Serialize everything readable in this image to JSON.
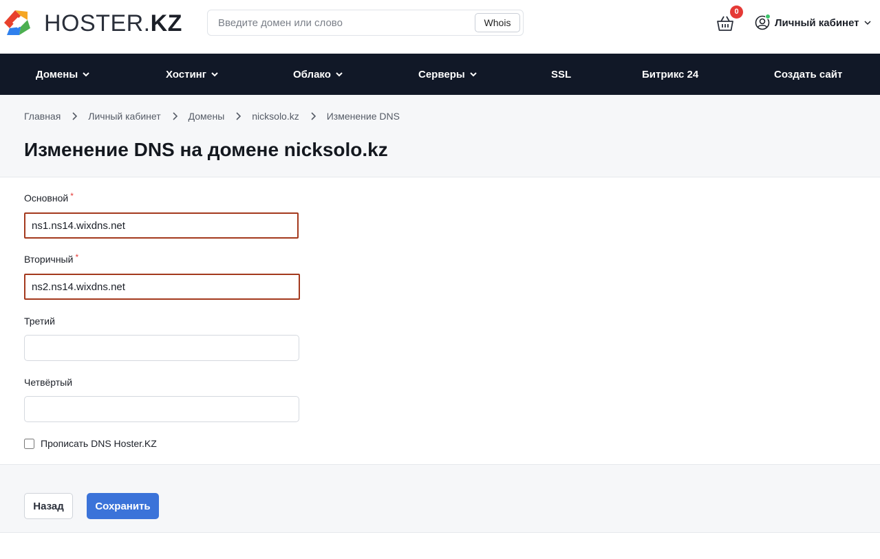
{
  "brand": {
    "name_light": "HOSTER.",
    "name_bold": "KZ"
  },
  "search": {
    "placeholder": "Введите домен или слово",
    "value": "",
    "button_label": "Whois"
  },
  "cart": {
    "count": "0"
  },
  "account": {
    "label": "Личный кабинет"
  },
  "nav": [
    {
      "label": "Домены",
      "has_dropdown": true
    },
    {
      "label": "Хостинг",
      "has_dropdown": true
    },
    {
      "label": "Облако",
      "has_dropdown": true
    },
    {
      "label": "Серверы",
      "has_dropdown": true
    },
    {
      "label": "SSL",
      "has_dropdown": false
    },
    {
      "label": "Битрикс 24",
      "has_dropdown": false
    },
    {
      "label": "Создать сайт",
      "has_dropdown": false
    }
  ],
  "breadcrumb": [
    "Главная",
    "Личный кабинет",
    "Домены",
    "nicksolo.kz",
    "Изменение DNS"
  ],
  "page_title": "Изменение DNS на домене nicksolo.kz",
  "form": {
    "primary": {
      "label": "Основной",
      "required_mark": "*",
      "value": "ns1.ns14.wixdns.net"
    },
    "secondary": {
      "label": "Вторичный",
      "required_mark": "*",
      "value": "ns2.ns14.wixdns.net"
    },
    "third": {
      "label": "Третий",
      "value": ""
    },
    "fourth": {
      "label": "Четвёртый",
      "value": ""
    },
    "use_hoster_dns": {
      "label": "Прописать DNS Hoster.KZ",
      "checked": false
    }
  },
  "actions": {
    "back_label": "Назад",
    "save_label": "Сохранить"
  },
  "colors": {
    "nav_bg": "#111827",
    "primary_button": "#3b73d9",
    "error_border": "#a3381c",
    "badge": "#e53935"
  }
}
